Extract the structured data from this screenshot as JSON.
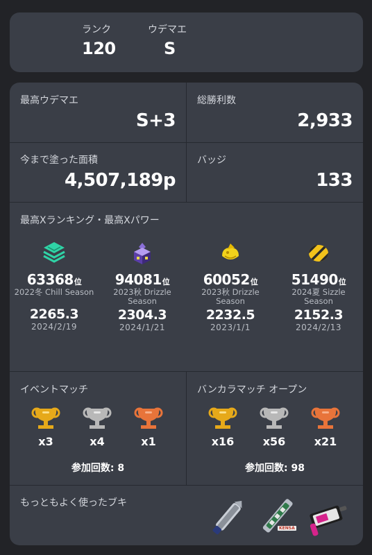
{
  "profile": {
    "rank_label": "ランク",
    "rank_value": "120",
    "udemae_label": "ウデマエ",
    "udemae_value": "S"
  },
  "stats": {
    "max_udemae_label": "最高ウデマエ",
    "max_udemae_value": "S+3",
    "wins_label": "総勝利数",
    "wins_value": "2,933",
    "paint_label": "今まで塗った面積",
    "paint_value": "4,507,189p",
    "badge_label": "バッジ",
    "badge_value": "133"
  },
  "xranking": {
    "title": "最高Xランキング・最高Xパワー",
    "entries": [
      {
        "icon": "green-stack-icon",
        "rank": "63368",
        "rank_suffix": "位",
        "season": "2022冬 Chill Season",
        "power": "2265.3",
        "date": "2024/2/19"
      },
      {
        "icon": "purple-tower-icon",
        "rank": "94081",
        "rank_suffix": "位",
        "season": "2023秋 Drizzle Season",
        "power": "2304.3",
        "date": "2024/1/21"
      },
      {
        "icon": "yellow-clam-icon",
        "rank": "60052",
        "rank_suffix": "位",
        "season": "2023秋 Drizzle Season",
        "power": "2232.5",
        "date": "2023/1/1"
      },
      {
        "icon": "yellow-striped-ball-icon",
        "rank": "51490",
        "rank_suffix": "位",
        "season": "2024夏 Sizzle Season",
        "power": "2152.3",
        "date": "2024/2/13"
      }
    ]
  },
  "event_match": {
    "title": "イベントマッチ",
    "gold": "x3",
    "silver": "x4",
    "bronze": "x1",
    "participation_label": "参加回数:",
    "participation_value": "8"
  },
  "bankara_open": {
    "title": "バンカラマッチ オープン",
    "gold": "x16",
    "silver": "x56",
    "bronze": "x21",
    "participation_label": "参加回数:",
    "participation_value": "98"
  },
  "weapons": {
    "title": "もっともよく使ったブキ",
    "items": [
      "chainsaw-weapon-icon",
      "splatling-weapon-icon",
      "brush-weapon-icon"
    ],
    "brand_tag": "KENSA"
  },
  "colors": {
    "background": "#222327",
    "card": "#3a3e47",
    "gold": "#e6a91a",
    "silver": "#b8b8b8",
    "bronze": "#e8743a"
  }
}
